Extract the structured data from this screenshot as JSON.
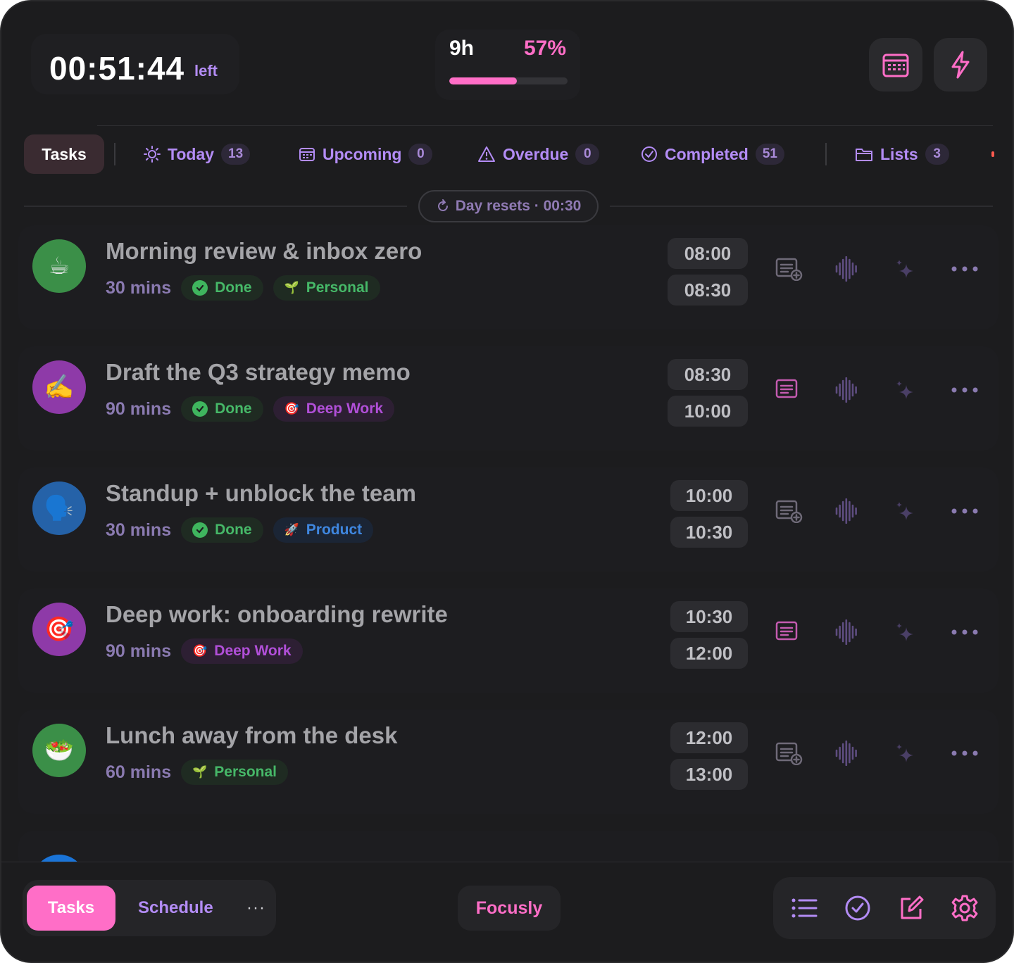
{
  "header": {
    "timer": "00:51:44",
    "timer_suffix": "left",
    "hours": "9h",
    "percent": "57%",
    "progress_fraction": 0.57
  },
  "tabs": {
    "active": "Tasks",
    "today": {
      "label": "Today",
      "count": "13"
    },
    "upcoming": {
      "label": "Upcoming",
      "count": "0"
    },
    "overdue": {
      "label": "Overdue",
      "count": "0"
    },
    "completed": {
      "label": "Completed",
      "count": "51"
    },
    "lists": {
      "label": "Lists",
      "count": "3"
    }
  },
  "day_reset": "Day resets · 00:30",
  "tasks": [
    {
      "emoji": "☕",
      "title": "Morning review & inbox zero",
      "duration": "30 mins",
      "status": "Done",
      "tag": "Personal",
      "tag_emoji": "🌱",
      "start": "08:00",
      "end": "08:30",
      "color": "#3b8f48"
    },
    {
      "emoji": "✍️",
      "title": "Draft the Q3 strategy memo",
      "duration": "90 mins",
      "status": "Done",
      "tag": "Deep Work",
      "tag_emoji": "🎯",
      "start": "08:30",
      "end": "10:00",
      "color": "#8e3aa8"
    },
    {
      "emoji": "🗣️",
      "title": "Standup + unblock the team",
      "duration": "30 mins",
      "status": "Done",
      "tag": "Product",
      "tag_emoji": "🚀",
      "start": "10:00",
      "end": "10:30",
      "color": "#2562a8"
    },
    {
      "emoji": "🎯",
      "title": "Deep work: onboarding rewrite",
      "duration": "90 mins",
      "status": "",
      "tag": "Deep Work",
      "tag_emoji": "🎯",
      "start": "10:30",
      "end": "12:00",
      "color": "#8e3aa8"
    },
    {
      "emoji": "🥗",
      "title": "Lunch away from the desk",
      "duration": "60 mins",
      "status": "",
      "tag": "Personal",
      "tag_emoji": "🌱",
      "start": "12:00",
      "end": "13:00",
      "color": "#3b8f48"
    }
  ],
  "bottom": {
    "tasks": "Tasks",
    "schedule": "Schedule",
    "more": "···",
    "brand": "Focusly"
  },
  "colors": {
    "accent": "#ff6ec7",
    "purple": "#b38cf5",
    "background": "#1c1c1e"
  },
  "icons": [
    "calendar-icon",
    "lightning-icon",
    "sun-icon",
    "calendar-small-icon",
    "warning-icon",
    "check-circle-icon",
    "folder-icon",
    "refresh-icon",
    "note-add-icon",
    "note-icon",
    "waveform-icon",
    "sparkle-icon",
    "more-icon",
    "list-icon",
    "check-icon",
    "edit-icon",
    "gear-icon"
  ]
}
